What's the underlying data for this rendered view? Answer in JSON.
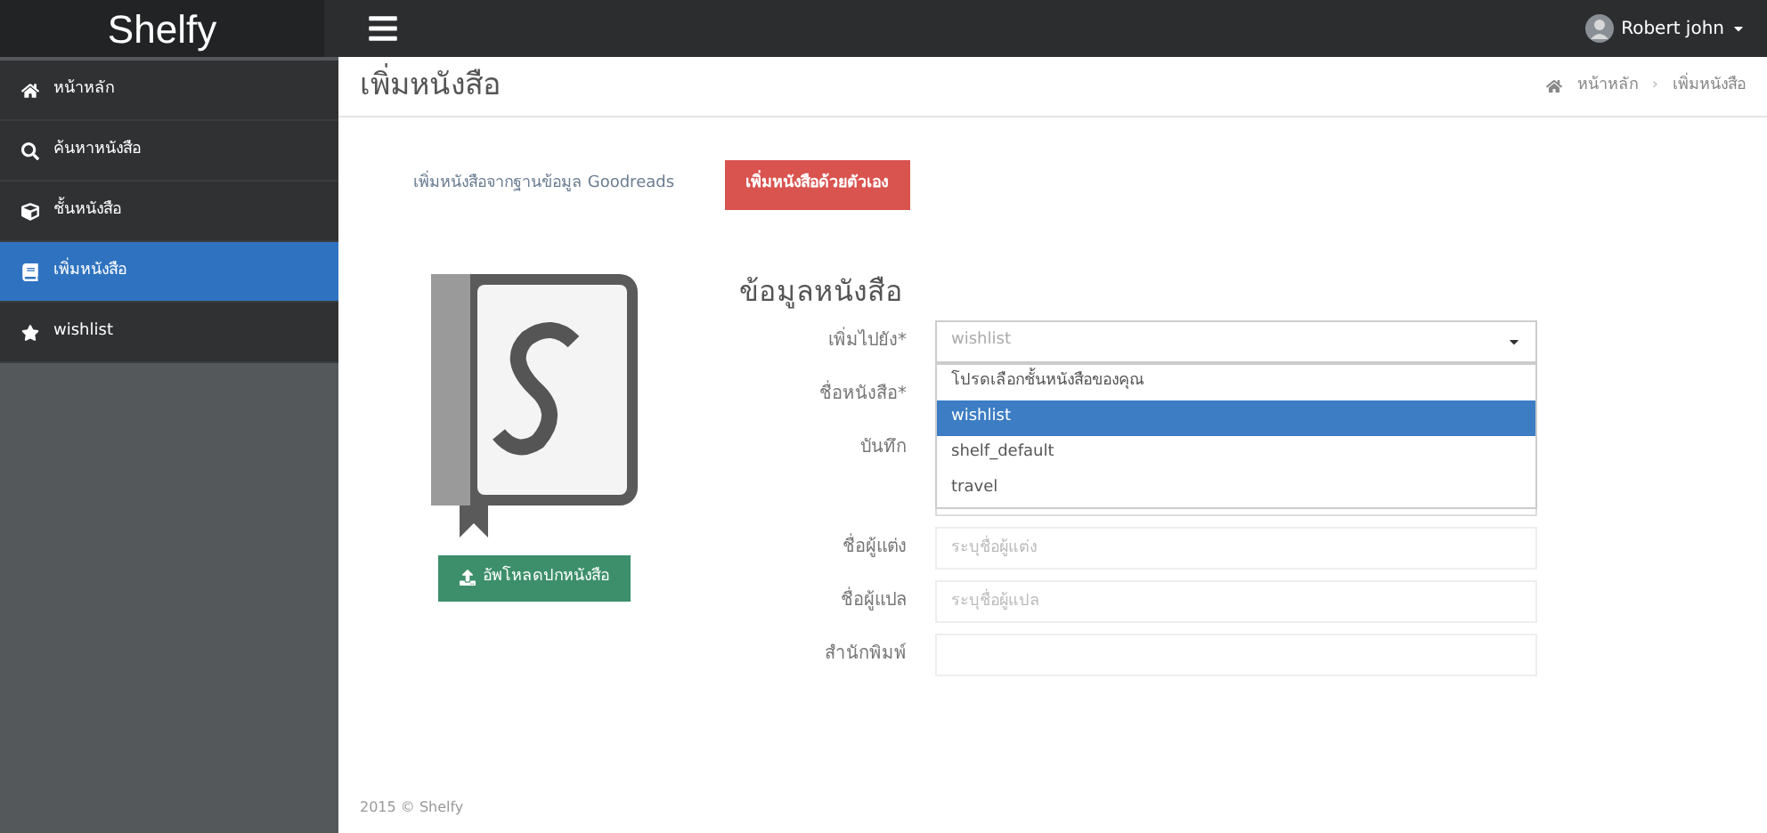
{
  "brand": "Shelfy",
  "user": {
    "name": "Robert john"
  },
  "sidebar": {
    "items": [
      {
        "label": "หน้าหลัก",
        "selected": false
      },
      {
        "label": "ค้นหาหนังสือ",
        "selected": false
      },
      {
        "label": "ชั้นหนังสือ",
        "selected": false
      },
      {
        "label": "เพิ่มหนังสือ",
        "selected": true
      },
      {
        "label": "wishlist",
        "selected": false
      }
    ]
  },
  "page": {
    "title": "เพิ่มหนังสือ",
    "breadcrumb": [
      "หน้าหลัก",
      "เพิ่มหนังสือ"
    ],
    "breadcrumb_separator": "›"
  },
  "source_tabs": [
    {
      "label": "เพิ่มหนังสือจากฐานข้อมูล Goodreads",
      "selected": false
    },
    {
      "label": "เพิ่มหนังสือด้วยตัวเอง",
      "selected": true
    }
  ],
  "upload_button": "อัพโหลดปกหนังสือ",
  "form": {
    "title": "ข้อมูลหนังสือ",
    "fields": [
      {
        "label": "เพิ่มไปยัง*",
        "kind": "select",
        "value": "wishlist",
        "expanded": true,
        "options": [
          {
            "label": "โปรดเลือกชั้นหนังสือของคุณ",
            "selected": false
          },
          {
            "label": "wishlist",
            "selected": true
          },
          {
            "label": "shelf_default",
            "selected": false
          },
          {
            "label": "travel",
            "selected": false
          }
        ]
      },
      {
        "label": "ชื่อหนังสือ*",
        "kind": "input"
      },
      {
        "label": "บันทึก",
        "kind": "textarea"
      },
      {
        "label": "ชื่อผู้แต่ง",
        "kind": "input",
        "placeholder": "ระบุชื่อผู้แต่ง"
      },
      {
        "label": "ชื่อผู้แปล",
        "kind": "input",
        "placeholder": "ระบุชื่อผู้แปล"
      },
      {
        "label": "สำนักพิมพ์",
        "kind": "input"
      }
    ]
  },
  "footer": "2015 © Shelfy"
}
